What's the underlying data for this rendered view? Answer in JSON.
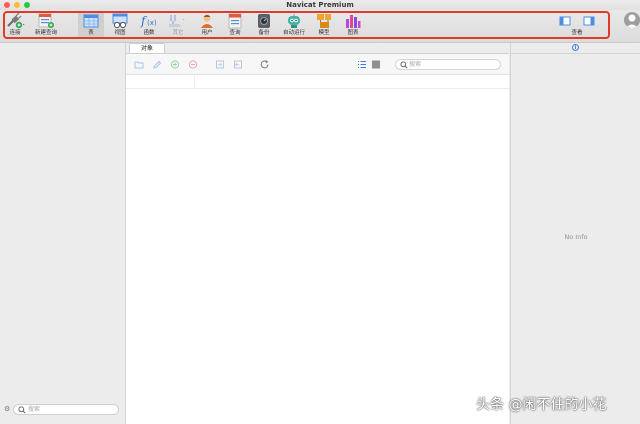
{
  "window": {
    "title": "Navicat Premium"
  },
  "toolbar": {
    "connect_label": "连接",
    "new_query_label": "新建查询",
    "table_label": "表",
    "view_label": "视图",
    "function_label": "函数",
    "other_label": "其它",
    "user_label": "用户",
    "query_label": "查询",
    "backup_label": "备份",
    "automation_label": "自动运行",
    "model_label": "模型",
    "chart_label": "图表",
    "view_toggle_label": "查看"
  },
  "center": {
    "tab_label": "对象",
    "search_placeholder": "搜索"
  },
  "left": {
    "search_placeholder": "搜索"
  },
  "right": {
    "no_info": "No Info"
  },
  "watermark": "头条 @闲不住的小花",
  "colors": {
    "highlight": "#e03a2c",
    "accent": "#3d7be0"
  }
}
